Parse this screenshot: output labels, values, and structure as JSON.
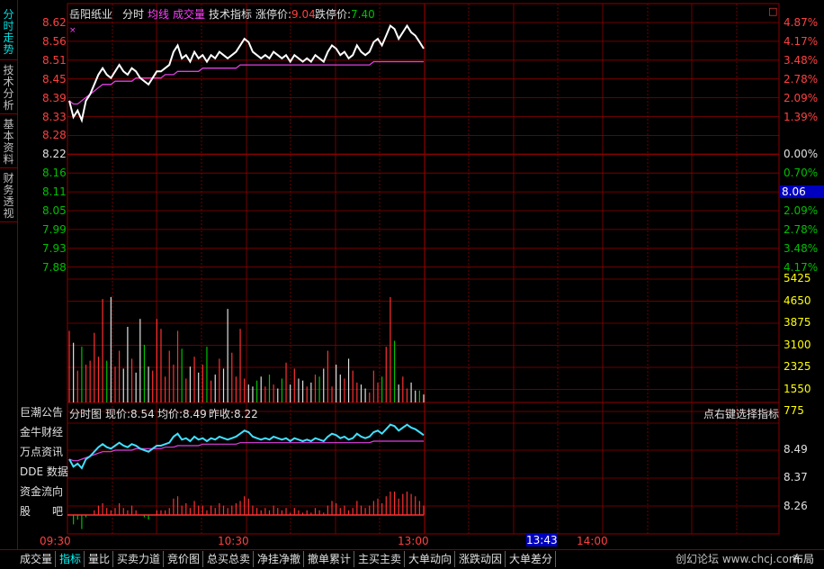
{
  "left_tabs": [
    {
      "label": "分时走势",
      "active": true
    },
    {
      "label": "技术分析",
      "active": false
    },
    {
      "label": "基本资料",
      "active": false
    },
    {
      "label": "财务透视",
      "active": false
    }
  ],
  "header": {
    "stock_name": "岳阳纸业",
    "tab_fenshi": "分时",
    "tab_junxian": "均线",
    "tab_chengjiaoliang": "成交量",
    "tab_jishu": "技术指标",
    "zhangting_label": "涨停价:",
    "zhangting_value": "9.04",
    "dieting_label": "跌停价:",
    "dieting_value": "7.40",
    "corner_box": "□",
    "marker": "×"
  },
  "price_axis": {
    "left": [
      "8.62",
      "8.56",
      "8.51",
      "8.45",
      "8.39",
      "8.33",
      "8.28",
      "8.22",
      "8.16",
      "8.11",
      "8.05",
      "7.99",
      "7.93",
      "7.88"
    ],
    "right": [
      "4.87%",
      "4.17%",
      "3.48%",
      "2.78%",
      "2.09%",
      "1.39%",
      "0.00%",
      "0.70%",
      "1.39%",
      "2.09%",
      "2.78%",
      "3.48%",
      "4.17%"
    ]
  },
  "current_price_tag": "8.06",
  "volume_axis": [
    "5425",
    "4650",
    "3875",
    "3100",
    "2325",
    "1550",
    "775"
  ],
  "side_list": [
    "巨潮公告",
    "金牛财经",
    "万点资讯",
    "DDE 数据",
    "资金流向",
    "股　　吧"
  ],
  "sub_chart": {
    "title": "分时图",
    "xianjia_label": "现价:",
    "xianjia": "8.54",
    "junjia_label": "均价:",
    "junjia": "8.49",
    "zuoshou_label": "昨收:",
    "zuoshou": "8.22",
    "hint": "点右键选择指标",
    "axis": [
      "8.49",
      "8.37",
      "8.26"
    ]
  },
  "time_axis": [
    "09:30",
    "10:30",
    "13:00",
    "14:00"
  ],
  "time_tag": "13:43",
  "bottom_tabs": [
    {
      "label": "成交量",
      "active": false
    },
    {
      "label": "指标",
      "active": true
    },
    {
      "label": "量比",
      "active": false
    },
    {
      "label": "买卖力道",
      "active": false
    },
    {
      "label": "竞价图",
      "active": false
    },
    {
      "label": "总买总卖",
      "active": false
    },
    {
      "label": "净挂净撤",
      "active": false
    },
    {
      "label": "撤单累计",
      "active": false
    },
    {
      "label": "主买主卖",
      "active": false
    },
    {
      "label": "大单动向",
      "active": false
    },
    {
      "label": "涨跌动因",
      "active": false
    },
    {
      "label": "大单差分",
      "active": false
    }
  ],
  "footer_brand": "创幻论坛 www.chcj.com",
  "footer_layout": "布局",
  "colors": {
    "grid": "#8b0000",
    "price_line": "#ffffff",
    "avg_line": "#e040e0",
    "sub_line": "#40e0ff",
    "up": "#ff3030",
    "down": "#00c000",
    "highlight": "#0000c0"
  },
  "chart_data": {
    "type": "line",
    "title": "",
    "xlabel": "",
    "ylabel": "",
    "x_ticks": [
      "09:30",
      "10:30",
      "13:00",
      "14:00"
    ],
    "ylim": [
      7.88,
      8.62
    ],
    "series": [
      {
        "values": [
          8.38,
          8.33,
          8.35,
          8.32,
          8.38,
          8.4,
          8.43,
          8.46,
          8.48,
          8.46,
          8.45,
          8.47,
          8.49,
          8.47,
          8.46,
          8.48,
          8.47,
          8.45,
          8.44,
          8.43,
          8.45,
          8.47,
          8.47,
          8.48,
          8.49,
          8.53,
          8.55,
          8.51,
          8.52,
          8.5,
          8.53,
          8.51,
          8.52,
          8.5,
          8.52,
          8.51,
          8.53,
          8.52,
          8.51,
          8.52,
          8.53,
          8.55,
          8.57,
          8.56,
          8.53,
          8.52,
          8.51,
          8.52,
          8.51,
          8.53,
          8.52,
          8.51,
          8.52,
          8.5,
          8.52,
          8.51,
          8.5,
          8.51,
          8.5,
          8.52,
          8.51,
          8.5,
          8.53,
          8.55,
          8.54,
          8.52,
          8.53,
          8.51,
          8.52,
          8.55,
          8.53,
          8.52,
          8.53,
          8.56,
          8.57,
          8.55,
          8.58,
          8.61,
          8.6,
          8.57,
          8.59,
          8.61,
          8.59,
          8.58,
          8.56,
          8.54
        ]
      },
      {
        "values": [
          8.38,
          8.37,
          8.37,
          8.38,
          8.39,
          8.4,
          8.41,
          8.42,
          8.43,
          8.43,
          8.43,
          8.44,
          8.44,
          8.44,
          8.44,
          8.44,
          8.45,
          8.45,
          8.45,
          8.45,
          8.45,
          8.45,
          8.45,
          8.46,
          8.46,
          8.46,
          8.47,
          8.47,
          8.47,
          8.47,
          8.47,
          8.47,
          8.48,
          8.48,
          8.48,
          8.48,
          8.48,
          8.48,
          8.48,
          8.48,
          8.48,
          8.49,
          8.49,
          8.49,
          8.49,
          8.49,
          8.49,
          8.49,
          8.49,
          8.49,
          8.49,
          8.49,
          8.49,
          8.49,
          8.49,
          8.49,
          8.49,
          8.49,
          8.49,
          8.49,
          8.49,
          8.49,
          8.49,
          8.49,
          8.49,
          8.49,
          8.49,
          8.49,
          8.49,
          8.49,
          8.49,
          8.49,
          8.49,
          8.5,
          8.5,
          8.5,
          8.5,
          8.5,
          8.5,
          8.5,
          8.5,
          8.5,
          8.5,
          8.5,
          8.5,
          8.5
        ]
      }
    ],
    "volume": [
      3600,
      3000,
      1600,
      2800,
      1900,
      2100,
      3500,
      2300,
      5200,
      2100,
      5300,
      1800,
      2600,
      1700,
      3800,
      2200,
      1500,
      4200,
      2900,
      1800,
      1600,
      4200,
      3700,
      1300,
      2600,
      1900,
      3600,
      2700,
      1200,
      1800,
      2300,
      1500,
      1900,
      2800,
      1100,
      1400,
      2200,
      1700,
      4700,
      2500,
      1300,
      3700,
      1200,
      900,
      800,
      1100,
      1300,
      800,
      1400,
      900,
      700,
      1200,
      2000,
      900,
      1700,
      1200,
      1100,
      800,
      1000,
      1400,
      1300,
      1700,
      2600,
      800,
      1900,
      1400,
      1200,
      2200,
      1600,
      1000,
      900,
      700,
      500,
      1600,
      1000,
      1300,
      2800,
      5300,
      3100,
      900,
      1300,
      700,
      1000,
      600,
      600,
      400
    ]
  }
}
